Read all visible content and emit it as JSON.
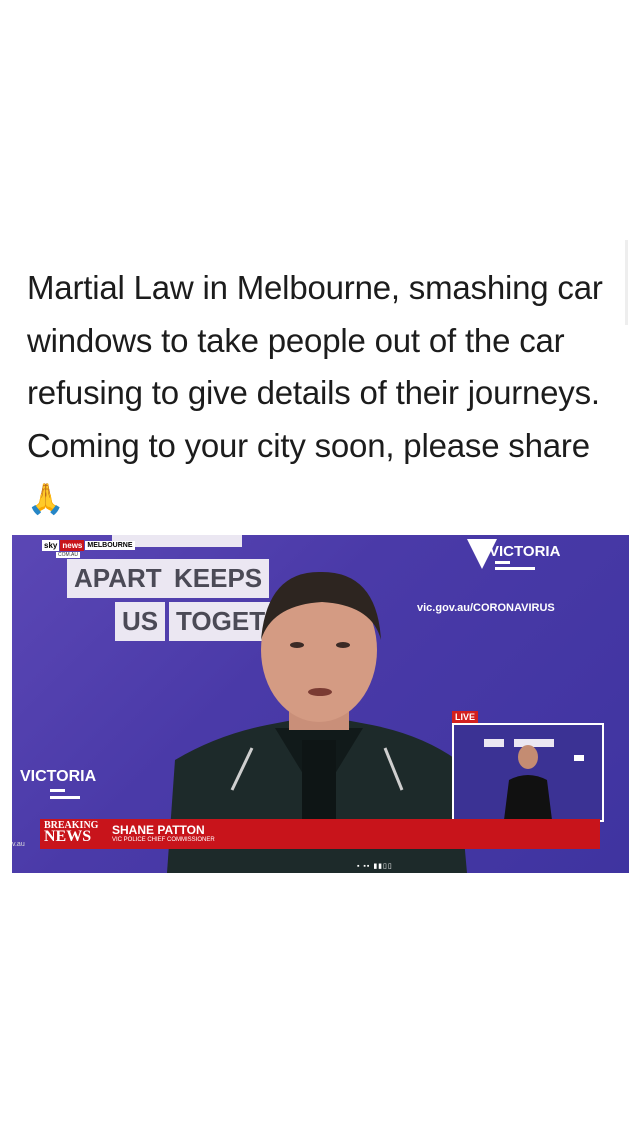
{
  "post": {
    "caption": "Martial Law in Melbourne, smashing car windows to take people out of the car refusing to give details of their journeys. Coming to your city soon, please share",
    "emoji": "🙏"
  },
  "video": {
    "sign_line1": [
      "APART",
      "KEEPS"
    ],
    "sign_line2": [
      "US",
      "TOGET"
    ],
    "brand_right": "VICTORIA",
    "url": "vic.gov.au/CORONAVIRUS",
    "brand_left": "VICTORIA",
    "live_label": "LIVE",
    "sky_logo": [
      "sky",
      "news",
      "MELBOURNE"
    ],
    "sky_sub": "COM.AU",
    "breaking_small": "BREAKING",
    "breaking_big": "NEWS",
    "name": "SHANE PATTON",
    "role": "VIC POLICE CHIEF COMMISSIONER",
    "left_edge": "v.au"
  },
  "colors": {
    "backdrop": "#4a3aa8",
    "ticker": "#c8141b",
    "sign": "#ebe7f2"
  }
}
